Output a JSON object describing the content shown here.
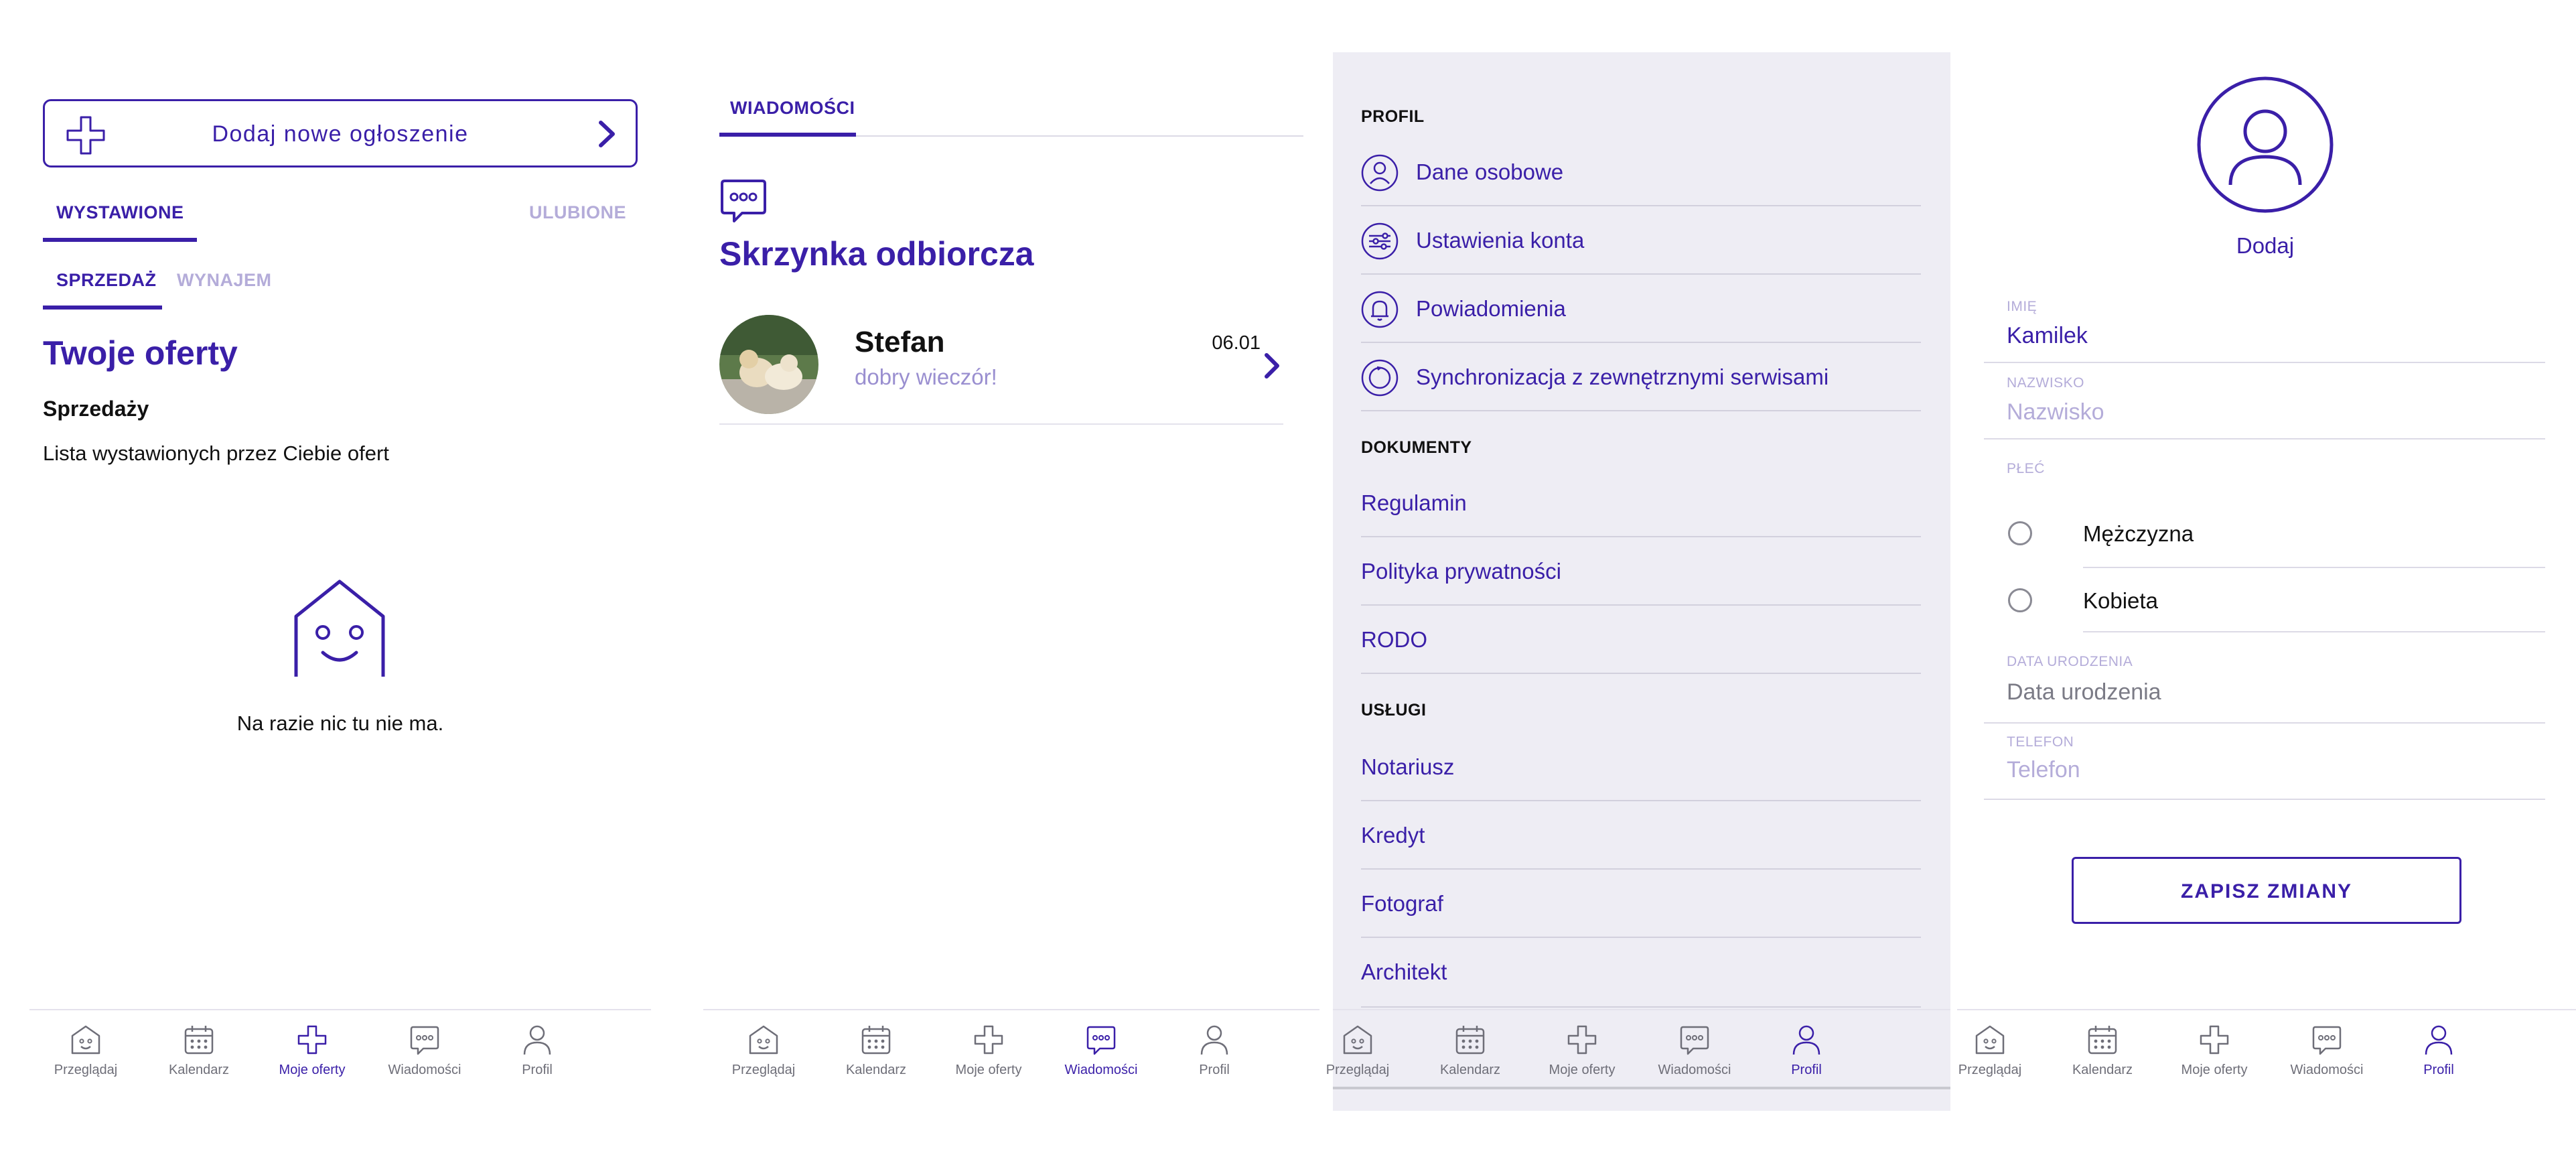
{
  "colors": {
    "accent": "#3a1fa8",
    "accent_light": "#b4acd9",
    "menu_bg": "#eeedf4"
  },
  "nav_labels": [
    "Przeglądaj",
    "Kalendarz",
    "Moje oferty",
    "Wiadomości",
    "Profil"
  ],
  "nav_icons": [
    "home-icon",
    "calendar-icon",
    "plus-icon",
    "chat-icon",
    "user-icon"
  ],
  "panel1": {
    "add_label": "Dodaj nowe ogłoszenie",
    "tabs": {
      "active": "WYSTAWIONE",
      "inactive": "ULUBIONE"
    },
    "subtabs": {
      "active": "SPRZEDAŻ",
      "inactive": "WYNAJEM"
    },
    "title": "Twoje oferty",
    "subtitle": "Sprzedaży",
    "description": "Lista wystawionych przez Ciebie ofert",
    "empty_text": "Na razie nic tu nie ma.",
    "active_nav": 2
  },
  "panel2": {
    "tab": "WIADOMOŚCI",
    "title": "Skrzynka odbiorcza",
    "message": {
      "sender": "Stefan",
      "preview": "dobry wieczór!",
      "date": "06.01"
    },
    "active_nav": 3
  },
  "panel3": {
    "profil_title": "PROFIL",
    "profil_items": [
      "Dane osobowe",
      "Ustawienia konta",
      "Powiadomienia",
      "Synchronizacja z zewnętrznymi serwisami"
    ],
    "dokumenty_title": "DOKUMENTY",
    "dokumenty_items": [
      "Regulamin",
      "Polityka prywatności",
      "RODO"
    ],
    "uslugi_title": "USŁUGI",
    "uslugi_items": [
      "Notariusz",
      "Kredyt",
      "Fotograf",
      "Architekt"
    ],
    "active_nav": 4
  },
  "panel4": {
    "avatar_action": "Dodaj",
    "imie_label": "IMIĘ",
    "imie_value": "Kamilek",
    "nazwisko_label": "NAZWISKO",
    "nazwisko_placeholder": "Nazwisko",
    "plec_label": "PŁEĆ",
    "plec_options": [
      "Mężczyzna",
      "Kobieta"
    ],
    "dob_label": "DATA URODZENIA",
    "dob_placeholder": "Data urodzenia",
    "tel_label": "TELEFON",
    "tel_placeholder": "Telefon",
    "save_label": "ZAPISZ ZMIANY",
    "active_nav": 4
  }
}
